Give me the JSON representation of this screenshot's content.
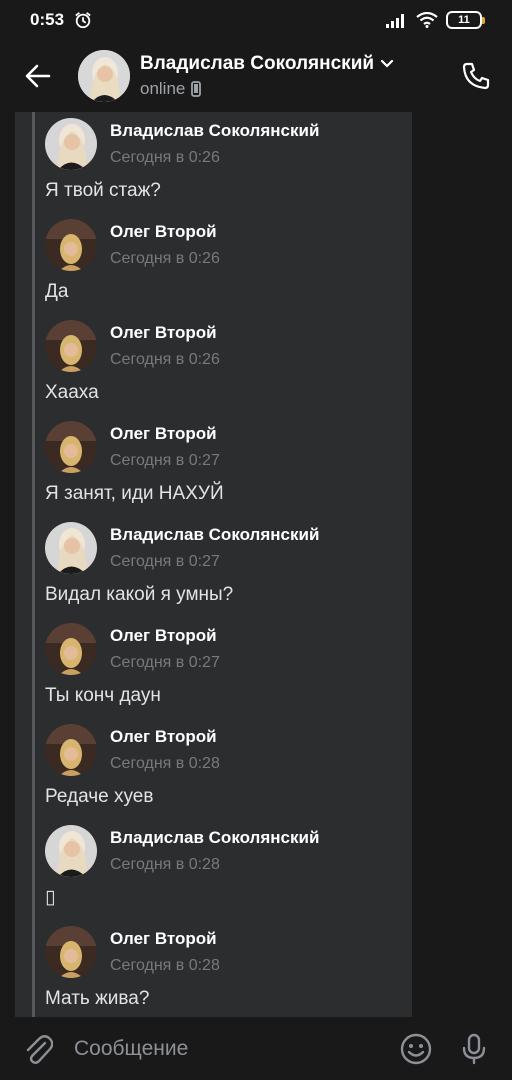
{
  "status": {
    "time": "0:53",
    "battery": "11"
  },
  "header": {
    "name": "Владислав Соколянский",
    "status": "online"
  },
  "messages": [
    {
      "author": "Владислав Соколянский",
      "date": "Сегодня в 0:26",
      "text": "Я твой стаж?",
      "avatar": "vlad"
    },
    {
      "author": "Олег Второй",
      "date": "Сегодня в 0:26",
      "text": "Да",
      "avatar": "oleg"
    },
    {
      "author": "Олег Второй",
      "date": "Сегодня в 0:26",
      "text": "Хааха",
      "avatar": "oleg"
    },
    {
      "author": "Олег Второй",
      "date": "Сегодня в 0:27",
      "text": "Я занят, иди НАХУЙ",
      "avatar": "oleg"
    },
    {
      "author": "Владислав Соколянский",
      "date": "Сегодня в 0:27",
      "text": "Видал какой я умны?",
      "avatar": "vlad"
    },
    {
      "author": "Олег Второй",
      "date": "Сегодня в 0:27",
      "text": "Ты конч даун",
      "avatar": "oleg"
    },
    {
      "author": "Олег Второй",
      "date": "Сегодня в 0:28",
      "text": "Редаче хуев",
      "avatar": "oleg"
    },
    {
      "author": "Владислав Соколянский",
      "date": "Сегодня в 0:28",
      "text": "▯",
      "avatar": "vlad"
    },
    {
      "author": "Олег Второй",
      "date": "Сегодня в 0:28",
      "text": "Мать жива?",
      "avatar": "oleg"
    }
  ],
  "composer": {
    "placeholder": "Сообщение"
  },
  "colors": {
    "background": "#19191a",
    "feed": "#2c2d2e",
    "quote_bar": "#58595c",
    "battery_accent": "#e8a23a"
  },
  "icons": [
    "alarm-icon",
    "signal-icon",
    "wifi-icon",
    "battery-icon",
    "back-arrow-icon",
    "chevron-down-icon",
    "mobile-icon",
    "phone-icon",
    "paperclip-icon",
    "smile-icon",
    "microphone-icon"
  ]
}
